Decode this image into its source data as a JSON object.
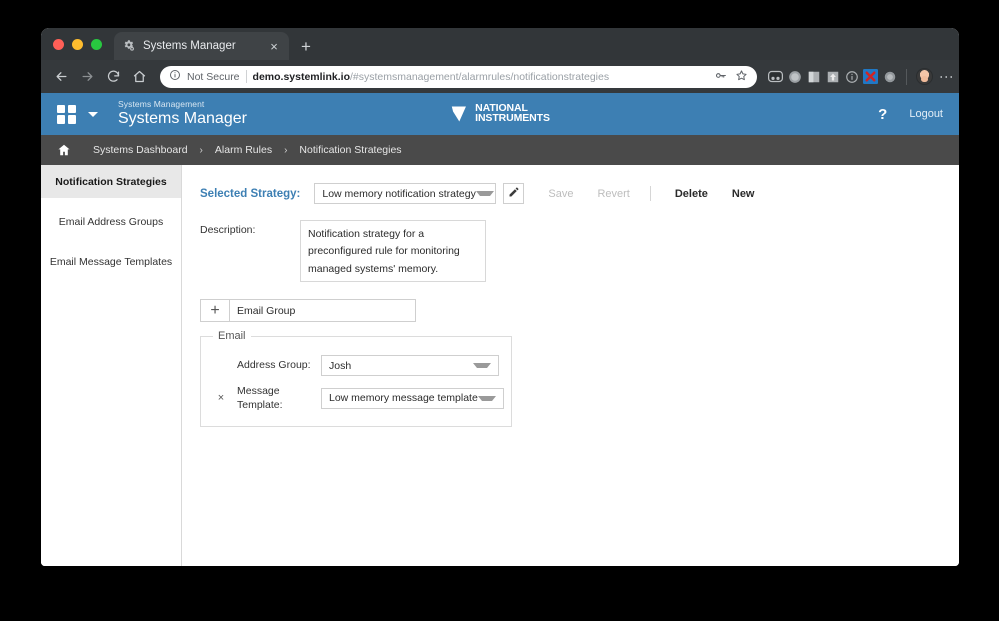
{
  "browser": {
    "tab": {
      "title": "Systems Manager",
      "favicon": "cog-icon",
      "close_label": "×"
    },
    "new_tab_label": "+",
    "nav": {
      "back": "←",
      "forward": "→",
      "reload": "↻",
      "home": "⌂"
    },
    "omnibox": {
      "security_text": "Not Secure",
      "url_domain": "demo.systemlink.io",
      "url_path": "/#systemsmanagement/alarmrules/notificationstrategies"
    },
    "extensions": [
      "goggles-icon",
      "circle-icon",
      "bookmark-icon",
      "arrow-up-icon",
      "info-circle-icon",
      "x-mark-icon",
      "disc-icon"
    ],
    "profile": "profile-avatar",
    "menu": "kebab-menu-icon"
  },
  "app_header": {
    "waffle": "apps-grid-icon",
    "suite_name": "Systems Management",
    "app_name": "Systems Manager",
    "logo_line1": "NATIONAL",
    "logo_line2": "INSTRUMENTS",
    "help_label": "?",
    "logout_label": "Logout",
    "background_color": "#3d7fb3"
  },
  "breadcrumb": {
    "home_icon": "home-icon",
    "separator": "›",
    "items": [
      {
        "label": "Systems Dashboard"
      },
      {
        "label": "Alarm Rules"
      },
      {
        "label": "Notification Strategies"
      }
    ],
    "background_color": "#4a4a4a"
  },
  "sidebar": {
    "items": [
      {
        "label": "Notification Strategies",
        "active": true
      },
      {
        "label": "Email Address Groups",
        "active": false
      },
      {
        "label": "Email Message Templates",
        "active": false
      }
    ]
  },
  "main": {
    "selected_strategy_label": "Selected Strategy:",
    "strategy_value": "Low memory notification strategy",
    "edit_icon": "pencil-icon",
    "actions": {
      "save": "Save",
      "revert": "Revert",
      "delete": "Delete",
      "new": "New"
    },
    "description_label": "Description:",
    "description_value": "Notification strategy for a preconfigured rule for monitoring managed systems' memory.",
    "add_row": {
      "plus": "+",
      "type_value": "Email Group"
    },
    "email_section": {
      "legend": "Email",
      "remove_label": "×",
      "address_group_label": "Address Group:",
      "address_group_value": "Josh",
      "message_template_label": "Message Template:",
      "message_template_value": "Low memory message template"
    }
  },
  "colors": {
    "accent_blue": "#3d7fb3",
    "breadcrumb_gray": "#4a4a4a",
    "sidebar_active": "#e8e8e8"
  }
}
